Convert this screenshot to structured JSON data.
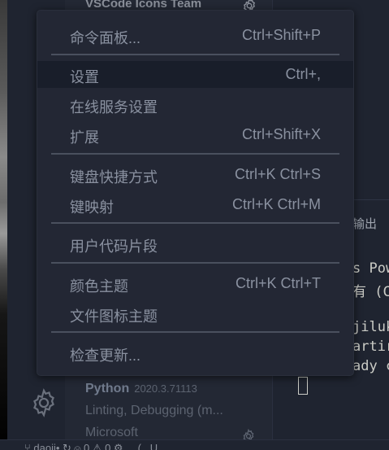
{
  "sidebar": {
    "top_extension_title": "VSCode Icons Team",
    "python": {
      "name": "Python",
      "version": "2020.3.71113",
      "description": "Linting, Debugging (m...",
      "publisher": "Microsoft"
    }
  },
  "panel": {
    "tab_label": "输出",
    "terminal_lines": [
      "s Pow",
      "有 (C",
      "",
      "jiluk",
      "artir",
      "ady c"
    ]
  },
  "statusbar": {
    "text": "⑂ daoji•  ↻  ⓧ 0 ⚠ 0  ⚙ ... (.. U"
  },
  "menu": {
    "items": [
      {
        "label": "命令面板...",
        "shortcut": "Ctrl+Shift+P"
      },
      {
        "label": "设置",
        "shortcut": "Ctrl+,"
      },
      {
        "label": "在线服务设置",
        "shortcut": ""
      },
      {
        "label": "扩展",
        "shortcut": "Ctrl+Shift+X"
      },
      {
        "label": "键盘快捷方式",
        "shortcut": "Ctrl+K Ctrl+S"
      },
      {
        "label": "键映射",
        "shortcut": "Ctrl+K Ctrl+M"
      },
      {
        "label": "用户代码片段",
        "shortcut": ""
      },
      {
        "label": "颜色主题",
        "shortcut": "Ctrl+K Ctrl+T"
      },
      {
        "label": "文件图标主题",
        "shortcut": ""
      },
      {
        "label": "检查更新...",
        "shortcut": ""
      }
    ],
    "active_item": "设置"
  },
  "icons": {
    "manage": "gear-icon",
    "extension_settings": "gear-icon"
  },
  "colors": {
    "background": "#1f2430",
    "menu_background": "#232734",
    "menu_highlight": "#191e2a",
    "menu_text": "#8a91a0",
    "separator": "#4a505e"
  }
}
